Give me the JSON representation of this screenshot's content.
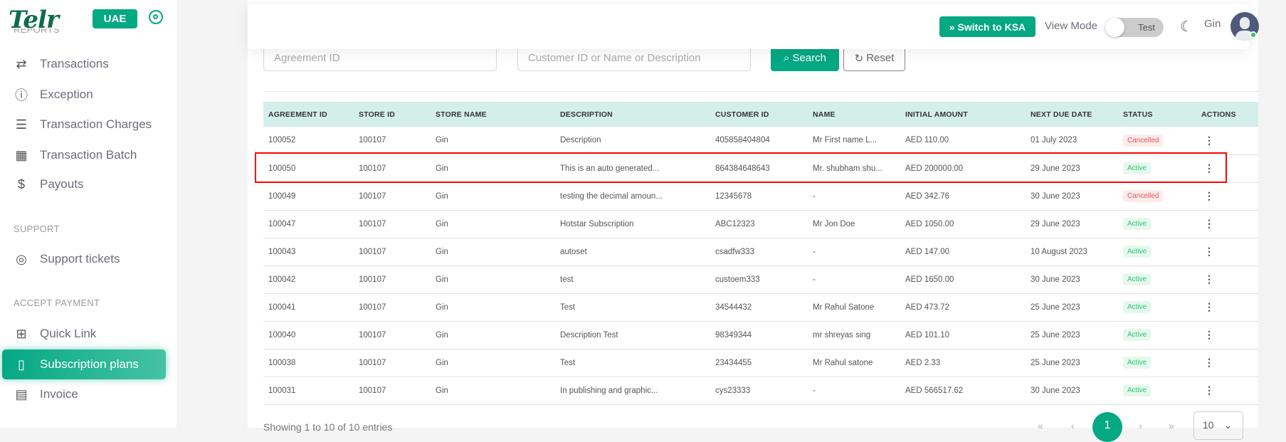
{
  "sidebar": {
    "logo": "Telr",
    "region": "UAE",
    "partial_section": "REPORTS",
    "items": [
      {
        "label": "Transactions",
        "icon": "arrows-swap-icon"
      },
      {
        "label": "Exception",
        "icon": "alert-circle-icon"
      },
      {
        "label": "Transaction Charges",
        "icon": "list-icon"
      },
      {
        "label": "Transaction Batch",
        "icon": "calendar-icon"
      },
      {
        "label": "Payouts",
        "icon": "dollar-icon"
      }
    ],
    "support_title": "SUPPORT",
    "support_items": [
      {
        "label": "Support tickets",
        "icon": "lifebuoy-icon"
      }
    ],
    "accept_title": "ACCEPT PAYMENT",
    "accept_items": [
      {
        "label": "Quick Link",
        "icon": "grid-icon"
      },
      {
        "label": "Subscription plans",
        "icon": "book-icon",
        "active": true
      },
      {
        "label": "Invoice",
        "icon": "file-text-icon"
      }
    ]
  },
  "header": {
    "switch_label": "» Switch to KSA",
    "view_mode_label": "View Mode",
    "view_mode_value": "Test",
    "user": "Gin"
  },
  "filters": {
    "agreement_placeholder": "Agreement ID",
    "customer_placeholder": "Customer ID or Name or Description",
    "search_label": "Search",
    "reset_label": "Reset"
  },
  "table": {
    "columns": [
      "AGREEMENT ID",
      "STORE ID",
      "STORE NAME",
      "DESCRIPTION",
      "CUSTOMER ID",
      "NAME",
      "INITIAL AMOUNT",
      "NEXT DUE DATE",
      "STATUS",
      "ACTIONS"
    ],
    "rows": [
      [
        "100052",
        "100107",
        "Gin",
        "Description",
        "405858404804",
        "Mr First name L...",
        "AED 110.00",
        "01 July 2023",
        "Cancelled"
      ],
      [
        "100050",
        "100107",
        "Gin",
        "This is an auto generated...",
        "864384648643",
        "Mr. shubham shu...",
        "AED 200000.00",
        "29 June 2023",
        "Active"
      ],
      [
        "100049",
        "100107",
        "Gin",
        "testing the decimal amoun...",
        "12345678",
        "-",
        "AED 342.76",
        "30 June 2023",
        "Cancelled"
      ],
      [
        "100047",
        "100107",
        "Gin",
        "Hotstar Subscription",
        "ABC12323",
        "Mr Jon Doe",
        "AED 1050.00",
        "29 June 2023",
        "Active"
      ],
      [
        "100043",
        "100107",
        "Gin",
        "autoset",
        "csadfw333",
        "-",
        "AED 147.00",
        "10 August 2023",
        "Active"
      ],
      [
        "100042",
        "100107",
        "Gin",
        "test",
        "custoem333",
        "-",
        "AED 1650.00",
        "30 June 2023",
        "Active"
      ],
      [
        "100041",
        "100107",
        "Gin",
        "Test",
        "34544432",
        "Mr Rahul Satone",
        "AED 473.72",
        "25 June 2023",
        "Active"
      ],
      [
        "100040",
        "100107",
        "Gin",
        "Description Test",
        "98349344",
        "mr shreyas sing",
        "AED 101.10",
        "25 June 2023",
        "Active"
      ],
      [
        "100038",
        "100107",
        "Gin",
        "Test",
        "23434455",
        "Mr Rahul satone",
        "AED 2.33",
        "25 June 2023",
        "Active"
      ],
      [
        "100031",
        "100107",
        "Gin",
        "In publishing and graphic...",
        "cys23333",
        "-",
        "AED 566517.62",
        "30 June 2023",
        "Active"
      ]
    ]
  },
  "footer": {
    "showing": "Showing 1 to 10 of 10 entries",
    "first": "«",
    "prev": "‹",
    "page": "1",
    "next": "›",
    "last": "»",
    "page_size": "10"
  },
  "colors": {
    "brand": "#04a883",
    "highlight": "#ff0000"
  }
}
